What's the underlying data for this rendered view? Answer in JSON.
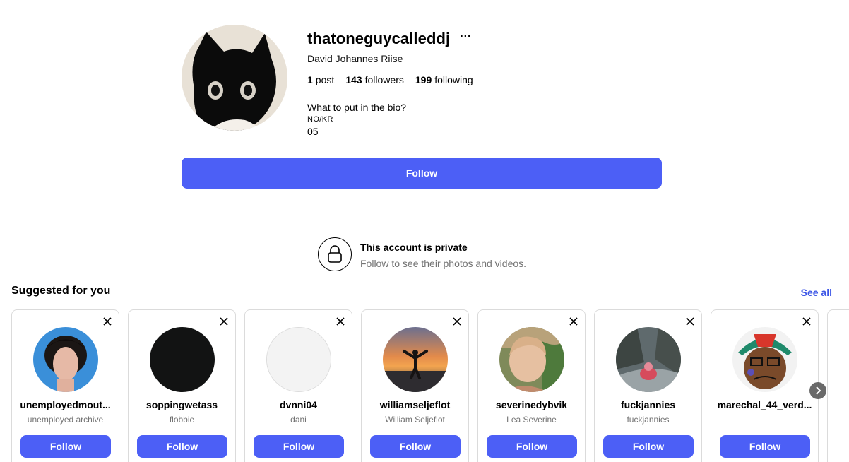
{
  "profile": {
    "username": "thatoneguycalleddj",
    "more_label": "···",
    "full_name": "David Johannes Riise",
    "stats": {
      "posts_count": "1",
      "posts_label": "post",
      "followers_count": "143",
      "followers_label": "followers",
      "following_count": "199",
      "following_label": "following"
    },
    "bio": {
      "line1": "What to put in the bio?",
      "line2": "NO/KR",
      "line3": "05"
    },
    "follow_label": "Follow"
  },
  "private_notice": {
    "title": "This account is private",
    "subtitle": "Follow to see their photos and videos."
  },
  "suggestions": {
    "title": "Suggested for you",
    "see_all_label": "See all",
    "cards": [
      {
        "username": "unemployedmout...",
        "subtitle": "unemployed archive",
        "follow_label": "Follow"
      },
      {
        "username": "soppingwetass",
        "subtitle": "flobbie",
        "follow_label": "Follow"
      },
      {
        "username": "dvnni04",
        "subtitle": "dani",
        "follow_label": "Follow"
      },
      {
        "username": "williamseljeflot",
        "subtitle": "William Seljeflot",
        "follow_label": "Follow"
      },
      {
        "username": "severinedybvik",
        "subtitle": "Lea Severine",
        "follow_label": "Follow"
      },
      {
        "username": "fuckjannies",
        "subtitle": "fuckjannies",
        "follow_label": "Follow"
      },
      {
        "username": "marechal_44_verd...",
        "subtitle": "",
        "follow_label": "Follow"
      }
    ]
  },
  "colors": {
    "accent": "#4c5ff6",
    "link": "#3b55e6",
    "muted_text": "#737373",
    "border": "#dbdbdb"
  },
  "icons": {
    "more": "ellipsis-icon",
    "lock": "lock-icon",
    "close": "close-icon",
    "next": "chevron-right-icon"
  }
}
